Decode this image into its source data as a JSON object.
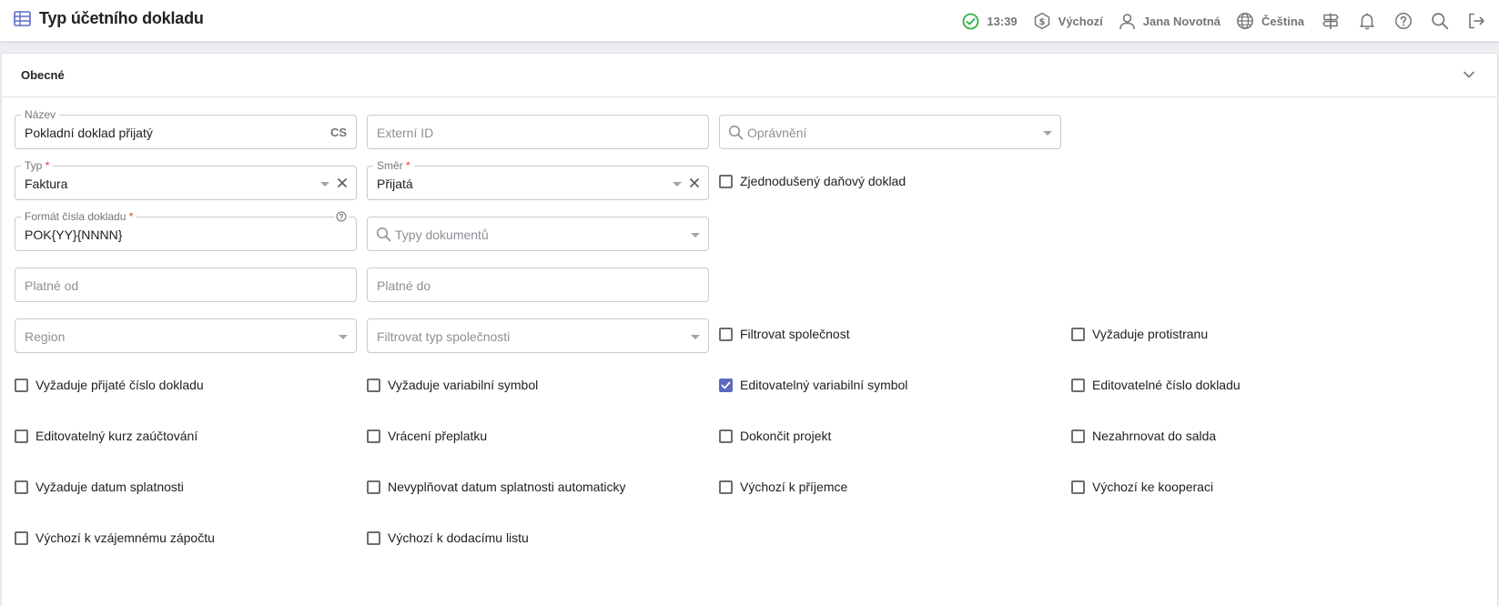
{
  "header": {
    "title": "Typ účetního dokladu",
    "status_time": "13:39",
    "currency_label": "Výchozí",
    "user_name": "Jana Novotná",
    "language": "Čeština",
    "accent_color": "#5c6bc0",
    "status_color": "#2fb344"
  },
  "panel": {
    "title": "Obecné"
  },
  "fields": {
    "nazev": {
      "label": "Název",
      "value": "Pokladní doklad přijatý",
      "lang": "CS"
    },
    "externi_id": {
      "placeholder": "Externí ID"
    },
    "opravneni": {
      "placeholder": "Oprávnění"
    },
    "typ": {
      "label": "Typ",
      "required": "*",
      "value": "Faktura"
    },
    "smer": {
      "label": "Směr",
      "required": "*",
      "value": "Přijatá"
    },
    "format": {
      "label": "Formát čísla dokladu",
      "required": "*",
      "value": "POK{YY}{NNNN}"
    },
    "typy_dokumentu": {
      "placeholder": "Typy dokumentů"
    },
    "platne_od": {
      "placeholder": "Platné od"
    },
    "platne_do": {
      "placeholder": "Platné do"
    },
    "region": {
      "placeholder": "Region"
    },
    "filtrovat_typ": {
      "placeholder": "Filtrovat typ společnosti"
    }
  },
  "checkboxes": [
    {
      "label": "Zjednodušený daňový doklad",
      "checked": false
    },
    {
      "label": "Filtrovat společnost",
      "checked": false
    },
    {
      "label": "Vyžaduje protistranu",
      "checked": false
    },
    {
      "label": "Vyžaduje přijaté číslo dokladu",
      "checked": false
    },
    {
      "label": "Vyžaduje variabilní symbol",
      "checked": false
    },
    {
      "label": "Editovatelný variabilní symbol",
      "checked": true
    },
    {
      "label": "Editovatelné číslo dokladu",
      "checked": false
    },
    {
      "label": "Editovatelný kurz zaúčtování",
      "checked": false
    },
    {
      "label": "Vrácení přeplatku",
      "checked": false
    },
    {
      "label": "Dokončit projekt",
      "checked": false
    },
    {
      "label": "Nezahrnovat do salda",
      "checked": false
    },
    {
      "label": "Vyžaduje datum splatnosti",
      "checked": false
    },
    {
      "label": "Nevyplňovat datum splatnosti automaticky",
      "checked": false
    },
    {
      "label": "Výchozí k příjemce",
      "checked": false
    },
    {
      "label": "Výchozí ke kooperaci",
      "checked": false
    },
    {
      "label": "Výchozí k vzájemnému zápočtu",
      "checked": false
    },
    {
      "label": "Výchozí k dodacímu listu",
      "checked": false
    }
  ]
}
